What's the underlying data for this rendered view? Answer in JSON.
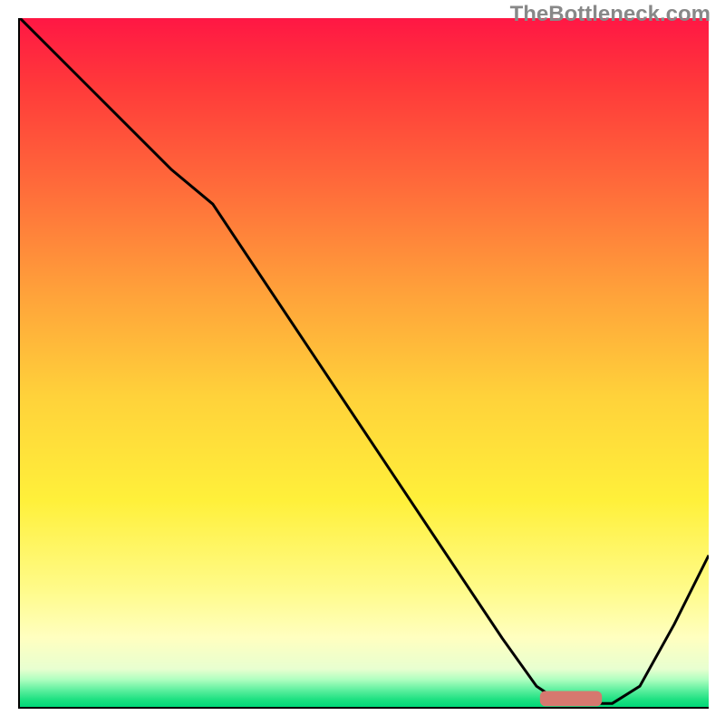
{
  "watermark": "TheBottleneck.com",
  "chart_data": {
    "type": "line",
    "title": "",
    "xlabel": "",
    "ylabel": "",
    "xlim": [
      0,
      100
    ],
    "ylim": [
      0,
      100
    ],
    "background_gradient": {
      "stops": [
        {
          "offset": 0.0,
          "color": "#ff1744"
        },
        {
          "offset": 0.1,
          "color": "#ff3a3a"
        },
        {
          "offset": 0.25,
          "color": "#ff6d3a"
        },
        {
          "offset": 0.4,
          "color": "#ffa23a"
        },
        {
          "offset": 0.55,
          "color": "#ffd23a"
        },
        {
          "offset": 0.7,
          "color": "#fff03a"
        },
        {
          "offset": 0.83,
          "color": "#fffb8a"
        },
        {
          "offset": 0.9,
          "color": "#ffffc0"
        },
        {
          "offset": 0.945,
          "color": "#e8ffd0"
        },
        {
          "offset": 0.96,
          "color": "#b0ffc0"
        },
        {
          "offset": 0.975,
          "color": "#60f0a0"
        },
        {
          "offset": 0.99,
          "color": "#1be080"
        },
        {
          "offset": 1.0,
          "color": "#00d878"
        }
      ]
    },
    "series": [
      {
        "name": "curve",
        "type": "line",
        "stroke": "#000000",
        "stroke_width": 3,
        "x": [
          0,
          10,
          22,
          28,
          40,
          50,
          60,
          70,
          75,
          78,
          82,
          86,
          90,
          95,
          100
        ],
        "y": [
          100,
          90,
          78,
          73,
          55,
          40,
          25,
          10,
          3,
          1,
          0.5,
          0.5,
          3,
          12,
          22
        ]
      }
    ],
    "marker": {
      "shape": "rounded-rect",
      "fill": "#d6786f",
      "x_center": 80,
      "y_center": 1.2,
      "width": 9,
      "height": 2.2
    }
  }
}
